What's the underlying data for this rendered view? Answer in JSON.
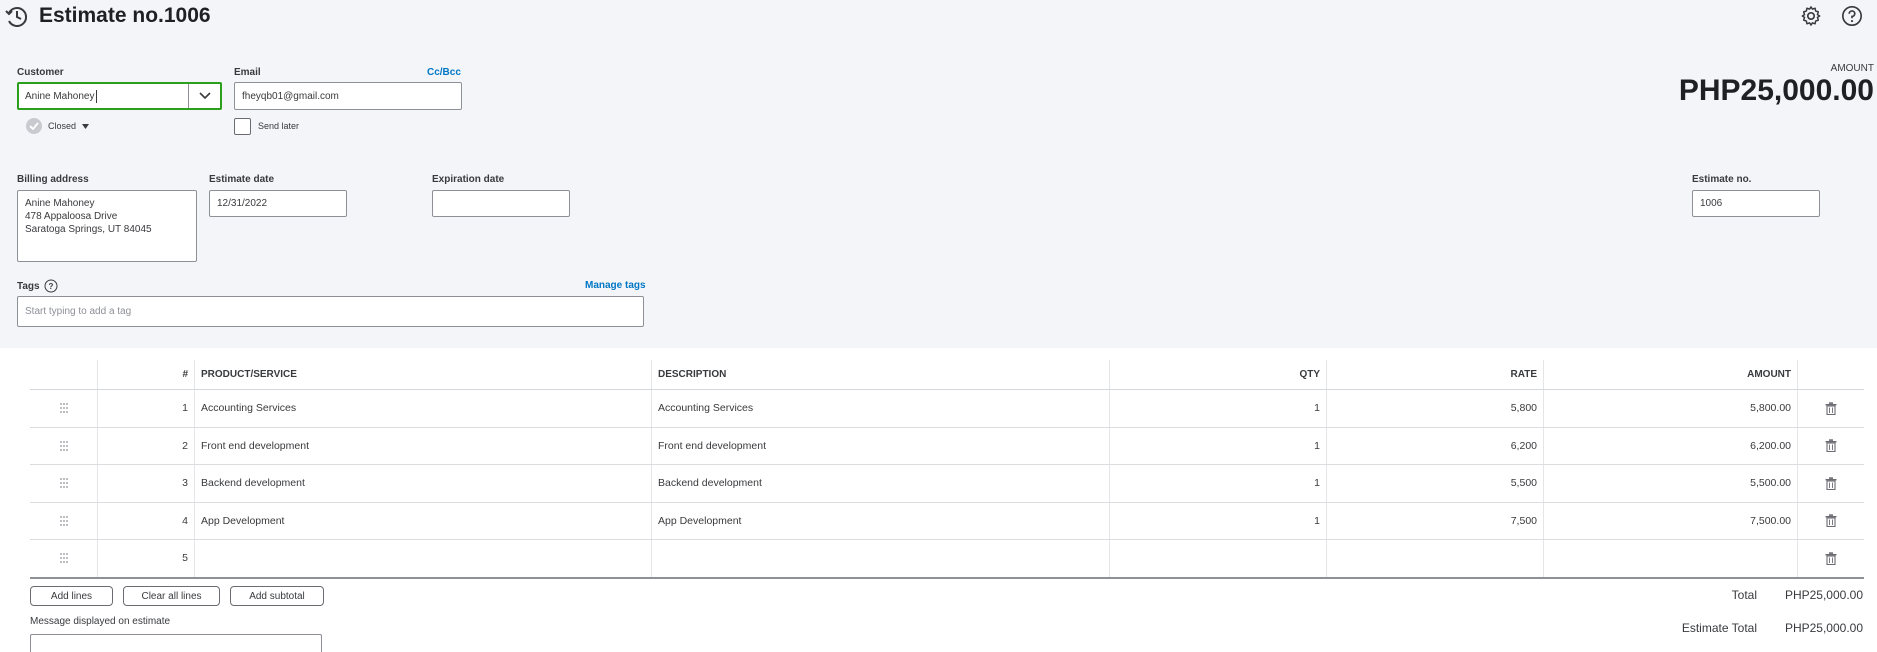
{
  "header": {
    "title": "Estimate no.1006",
    "history_icon": "clock-history-icon",
    "settings_icon": "gear-icon",
    "help_icon": "help-circle-icon"
  },
  "customer": {
    "label": "Customer",
    "value": "Anine Mahoney",
    "status": "Closed"
  },
  "email": {
    "label": "Email",
    "value": "fheyqb01@gmail.com",
    "cc_bcc_link": "Cc/Bcc",
    "send_later_label": "Send later"
  },
  "amount": {
    "label": "AMOUNT",
    "value": "PHP25,000.00"
  },
  "billing": {
    "label": "Billing address",
    "lines": [
      "Anine Mahoney",
      "478 Appaloosa Drive",
      "Saratoga Springs, UT  84045"
    ]
  },
  "estimate_date": {
    "label": "Estimate date",
    "value": "12/31/2022"
  },
  "expiration_date": {
    "label": "Expiration date",
    "value": ""
  },
  "estimate_no": {
    "label": "Estimate no.",
    "value": "1006"
  },
  "tags": {
    "label": "Tags",
    "manage_link": "Manage tags",
    "placeholder": "Start typing to add a tag"
  },
  "table": {
    "headers": {
      "num": "#",
      "product": "PRODUCT/SERVICE",
      "description": "DESCRIPTION",
      "qty": "QTY",
      "rate": "RATE",
      "amount": "AMOUNT"
    },
    "rows": [
      {
        "num": "1",
        "product": "Accounting Services",
        "description": "Accounting Services",
        "qty": "1",
        "rate": "5,800",
        "amount": "5,800.00"
      },
      {
        "num": "2",
        "product": "Front end development",
        "description": "Front end development",
        "qty": "1",
        "rate": "6,200",
        "amount": "6,200.00"
      },
      {
        "num": "3",
        "product": "Backend development",
        "description": "Backend development",
        "qty": "1",
        "rate": "5,500",
        "amount": "5,500.00"
      },
      {
        "num": "4",
        "product": "App Development",
        "description": "App Development",
        "qty": "1",
        "rate": "7,500",
        "amount": "7,500.00"
      },
      {
        "num": "5",
        "product": "",
        "description": "",
        "qty": "",
        "rate": "",
        "amount": ""
      }
    ]
  },
  "actions": {
    "add_lines": "Add lines",
    "clear_all_lines": "Clear all lines",
    "add_subtotal": "Add subtotal"
  },
  "message": {
    "label": "Message displayed on estimate",
    "value": ""
  },
  "totals": {
    "total_label": "Total",
    "total_value": "PHP25,000.00",
    "estimate_total_label": "Estimate Total",
    "estimate_total_value": "PHP25,000.00"
  },
  "colors": {
    "accent_green": "#2ca01c",
    "link_blue": "#0077c5",
    "header_bg": "#f4f5f8"
  }
}
